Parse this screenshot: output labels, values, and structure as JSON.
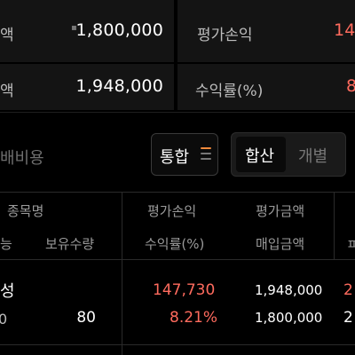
{
  "summary": {
    "row1_left_label_fragment": "액",
    "row1_left_value": "1,800,000",
    "row1_right_label": "평가손익",
    "row1_right_value_fragment": "14",
    "row2_left_label_fragment": "액",
    "row2_left_value": "1,948,000",
    "row2_right_label": "수익률(%)",
    "row2_right_value_fragment": "8"
  },
  "controls": {
    "cost_label_fragment": "배비용",
    "merge_button_label": "통합",
    "view_toggle": [
      "합산",
      "개별"
    ],
    "selected_view": "합산"
  },
  "table": {
    "header_row1": [
      "종목명",
      "평가손익",
      "평가금액"
    ],
    "header_row2_left_fragment": "능",
    "header_row2": [
      "보유수량",
      "수익률(%)",
      "매입금액"
    ],
    "header_row2_right_fragment": "ㅍ",
    "rows": [
      {
        "name_fragment": "성",
        "left_fragment": "0",
        "quantity": "80",
        "profit": "147,730",
        "return_rate": "8.21%",
        "eval_amount": "1,948,000",
        "purchase_amount": "1,800,000",
        "right_fragment_1": "2",
        "right_fragment_2": "2"
      }
    ]
  },
  "colors": {
    "background": "#000000",
    "panel": "#141414",
    "gain_red": "#ff6b5e",
    "merge_icon_orange": "#f08a3c"
  }
}
